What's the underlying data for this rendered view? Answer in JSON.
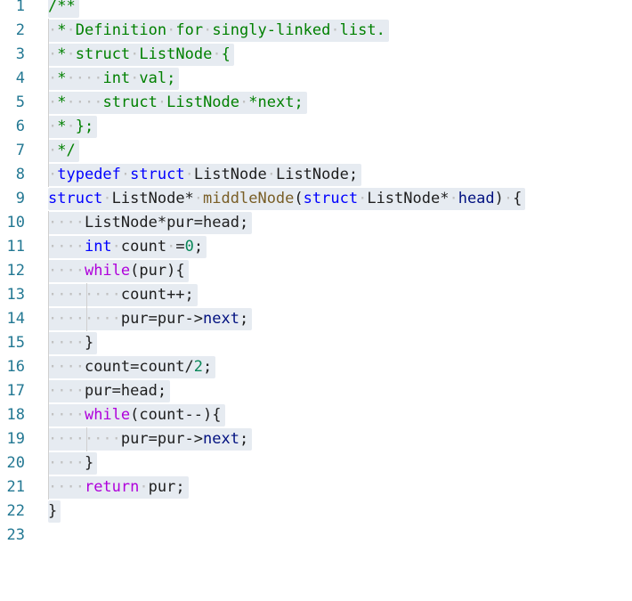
{
  "editor": {
    "lines": [
      {
        "num": "1",
        "tokens": [
          {
            "t": "/**",
            "k": "c-comment"
          }
        ]
      },
      {
        "num": "2",
        "tokens": [
          {
            "t": "·",
            "k": "c-ws"
          },
          {
            "t": "*",
            "k": "c-comment"
          },
          {
            "t": "·",
            "k": "c-ws"
          },
          {
            "t": "Definition",
            "k": "c-comment"
          },
          {
            "t": "·",
            "k": "c-ws"
          },
          {
            "t": "for",
            "k": "c-comment"
          },
          {
            "t": "·",
            "k": "c-ws"
          },
          {
            "t": "singly-linked",
            "k": "c-comment"
          },
          {
            "t": "·",
            "k": "c-ws"
          },
          {
            "t": "list.",
            "k": "c-comment"
          }
        ]
      },
      {
        "num": "3",
        "tokens": [
          {
            "t": "·",
            "k": "c-ws"
          },
          {
            "t": "*",
            "k": "c-comment"
          },
          {
            "t": "·",
            "k": "c-ws"
          },
          {
            "t": "struct",
            "k": "c-comment"
          },
          {
            "t": "·",
            "k": "c-ws"
          },
          {
            "t": "ListNode",
            "k": "c-comment"
          },
          {
            "t": "·",
            "k": "c-ws"
          },
          {
            "t": "{",
            "k": "c-comment"
          }
        ]
      },
      {
        "num": "4",
        "tokens": [
          {
            "t": "·",
            "k": "c-ws"
          },
          {
            "t": "*",
            "k": "c-comment"
          },
          {
            "t": "····",
            "k": "c-ws"
          },
          {
            "t": "int",
            "k": "c-comment"
          },
          {
            "t": "·",
            "k": "c-ws"
          },
          {
            "t": "val;",
            "k": "c-comment"
          }
        ]
      },
      {
        "num": "5",
        "tokens": [
          {
            "t": "·",
            "k": "c-ws"
          },
          {
            "t": "*",
            "k": "c-comment"
          },
          {
            "t": "····",
            "k": "c-ws"
          },
          {
            "t": "struct",
            "k": "c-comment"
          },
          {
            "t": "·",
            "k": "c-ws"
          },
          {
            "t": "ListNode",
            "k": "c-comment"
          },
          {
            "t": "·",
            "k": "c-ws"
          },
          {
            "t": "*next;",
            "k": "c-comment"
          }
        ]
      },
      {
        "num": "6",
        "tokens": [
          {
            "t": "·",
            "k": "c-ws"
          },
          {
            "t": "*",
            "k": "c-comment"
          },
          {
            "t": "·",
            "k": "c-ws"
          },
          {
            "t": "};",
            "k": "c-comment"
          }
        ]
      },
      {
        "num": "7",
        "tokens": [
          {
            "t": "·",
            "k": "c-ws"
          },
          {
            "t": "*/",
            "k": "c-comment"
          }
        ]
      },
      {
        "num": "8",
        "tokens": [
          {
            "t": "·",
            "k": "c-ws"
          },
          {
            "t": "typedef",
            "k": "c-kw"
          },
          {
            "t": "·",
            "k": "c-ws"
          },
          {
            "t": "struct",
            "k": "c-kw"
          },
          {
            "t": "·",
            "k": "c-ws"
          },
          {
            "t": "ListNode",
            "k": "c-plain"
          },
          {
            "t": "·",
            "k": "c-ws"
          },
          {
            "t": "ListNode;",
            "k": "c-plain"
          }
        ]
      },
      {
        "num": "9",
        "tokens": [
          {
            "t": "struct",
            "k": "c-kw"
          },
          {
            "t": "·",
            "k": "c-ws"
          },
          {
            "t": "ListNode*",
            "k": "c-plain"
          },
          {
            "t": "·",
            "k": "c-ws"
          },
          {
            "t": "middleNode",
            "k": "c-fn"
          },
          {
            "t": "(",
            "k": "c-plain"
          },
          {
            "t": "struct",
            "k": "c-kw"
          },
          {
            "t": "·",
            "k": "c-ws"
          },
          {
            "t": "ListNode*",
            "k": "c-plain"
          },
          {
            "t": "·",
            "k": "c-ws"
          },
          {
            "t": "head",
            "k": "c-var"
          },
          {
            "t": ")",
            "k": "c-plain"
          },
          {
            "t": "·",
            "k": "c-ws"
          },
          {
            "t": "{",
            "k": "c-plain"
          }
        ]
      },
      {
        "num": "10",
        "tokens": [
          {
            "t": "····",
            "k": "c-ws"
          },
          {
            "t": "ListNode*pur=head;",
            "k": "c-plain"
          }
        ]
      },
      {
        "num": "11",
        "tokens": [
          {
            "t": "····",
            "k": "c-ws"
          },
          {
            "t": "int",
            "k": "c-kw"
          },
          {
            "t": "·",
            "k": "c-ws"
          },
          {
            "t": "count",
            "k": "c-plain"
          },
          {
            "t": "·",
            "k": "c-ws"
          },
          {
            "t": "=",
            "k": "c-plain"
          },
          {
            "t": "0",
            "k": "c-num"
          },
          {
            "t": ";",
            "k": "c-plain"
          }
        ]
      },
      {
        "num": "12",
        "tokens": [
          {
            "t": "····",
            "k": "c-ws"
          },
          {
            "t": "while",
            "k": "c-kw2"
          },
          {
            "t": "(pur){",
            "k": "c-plain"
          }
        ]
      },
      {
        "num": "13",
        "tokens": [
          {
            "t": "········",
            "k": "c-ws"
          },
          {
            "t": "count++;",
            "k": "c-plain"
          }
        ]
      },
      {
        "num": "14",
        "tokens": [
          {
            "t": "········",
            "k": "c-ws"
          },
          {
            "t": "pur=pur->",
            "k": "c-plain"
          },
          {
            "t": "next",
            "k": "c-var"
          },
          {
            "t": ";",
            "k": "c-plain"
          }
        ]
      },
      {
        "num": "15",
        "tokens": [
          {
            "t": "····",
            "k": "c-ws"
          },
          {
            "t": "}",
            "k": "c-plain"
          }
        ]
      },
      {
        "num": "16",
        "tokens": [
          {
            "t": "····",
            "k": "c-ws"
          },
          {
            "t": "count=count/",
            "k": "c-plain"
          },
          {
            "t": "2",
            "k": "c-num"
          },
          {
            "t": ";",
            "k": "c-plain"
          }
        ]
      },
      {
        "num": "17",
        "tokens": [
          {
            "t": "····",
            "k": "c-ws"
          },
          {
            "t": "pur=head;",
            "k": "c-plain"
          }
        ]
      },
      {
        "num": "18",
        "tokens": [
          {
            "t": "····",
            "k": "c-ws"
          },
          {
            "t": "while",
            "k": "c-kw2"
          },
          {
            "t": "(count--){",
            "k": "c-plain"
          }
        ]
      },
      {
        "num": "19",
        "tokens": [
          {
            "t": "········",
            "k": "c-ws"
          },
          {
            "t": "pur=pur->",
            "k": "c-plain"
          },
          {
            "t": "next",
            "k": "c-var"
          },
          {
            "t": ";",
            "k": "c-plain"
          }
        ]
      },
      {
        "num": "20",
        "tokens": [
          {
            "t": "····",
            "k": "c-ws"
          },
          {
            "t": "}",
            "k": "c-plain"
          }
        ]
      },
      {
        "num": "21",
        "tokens": [
          {
            "t": "····",
            "k": "c-ws"
          },
          {
            "t": "return",
            "k": "c-kw2"
          },
          {
            "t": "·",
            "k": "c-ws"
          },
          {
            "t": "pur;",
            "k": "c-plain"
          }
        ]
      },
      {
        "num": "22",
        "tokens": [
          {
            "t": "}",
            "k": "c-plain"
          }
        ]
      },
      {
        "num": "23",
        "tokens": []
      }
    ]
  },
  "colors": {
    "line_number": "#237893",
    "comment": "#008000",
    "keyword": "#0000ff",
    "control_keyword": "#af00db",
    "function": "#795e26",
    "number": "#098658",
    "selection": "#e6ebf1"
  }
}
